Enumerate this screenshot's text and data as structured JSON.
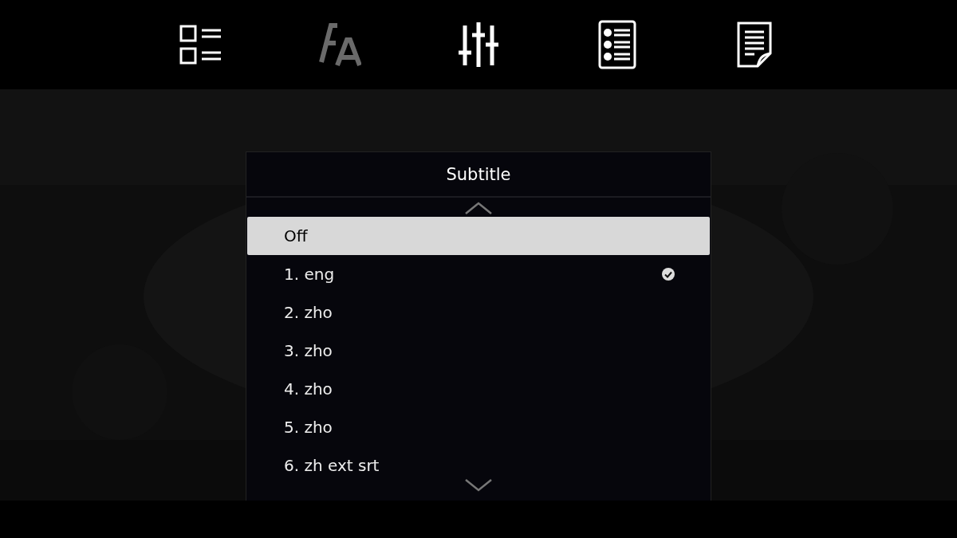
{
  "toolbar": [
    {
      "kind": "checklist",
      "disabled": false
    },
    {
      "kind": "font",
      "disabled": true
    },
    {
      "kind": "sliders",
      "disabled": false
    },
    {
      "kind": "numbered",
      "disabled": false
    },
    {
      "kind": "document",
      "disabled": false
    }
  ],
  "menu": {
    "title": "Subtitle",
    "items": [
      {
        "label": "Off",
        "selected": true,
        "checked": false
      },
      {
        "label": "1. eng",
        "selected": false,
        "checked": true
      },
      {
        "label": "2. zho",
        "selected": false,
        "checked": false
      },
      {
        "label": "3. zho",
        "selected": false,
        "checked": false
      },
      {
        "label": "4. zho",
        "selected": false,
        "checked": false
      },
      {
        "label": "5. zho",
        "selected": false,
        "checked": false
      },
      {
        "label": "6. zh ext srt",
        "selected": false,
        "checked": false
      }
    ]
  }
}
